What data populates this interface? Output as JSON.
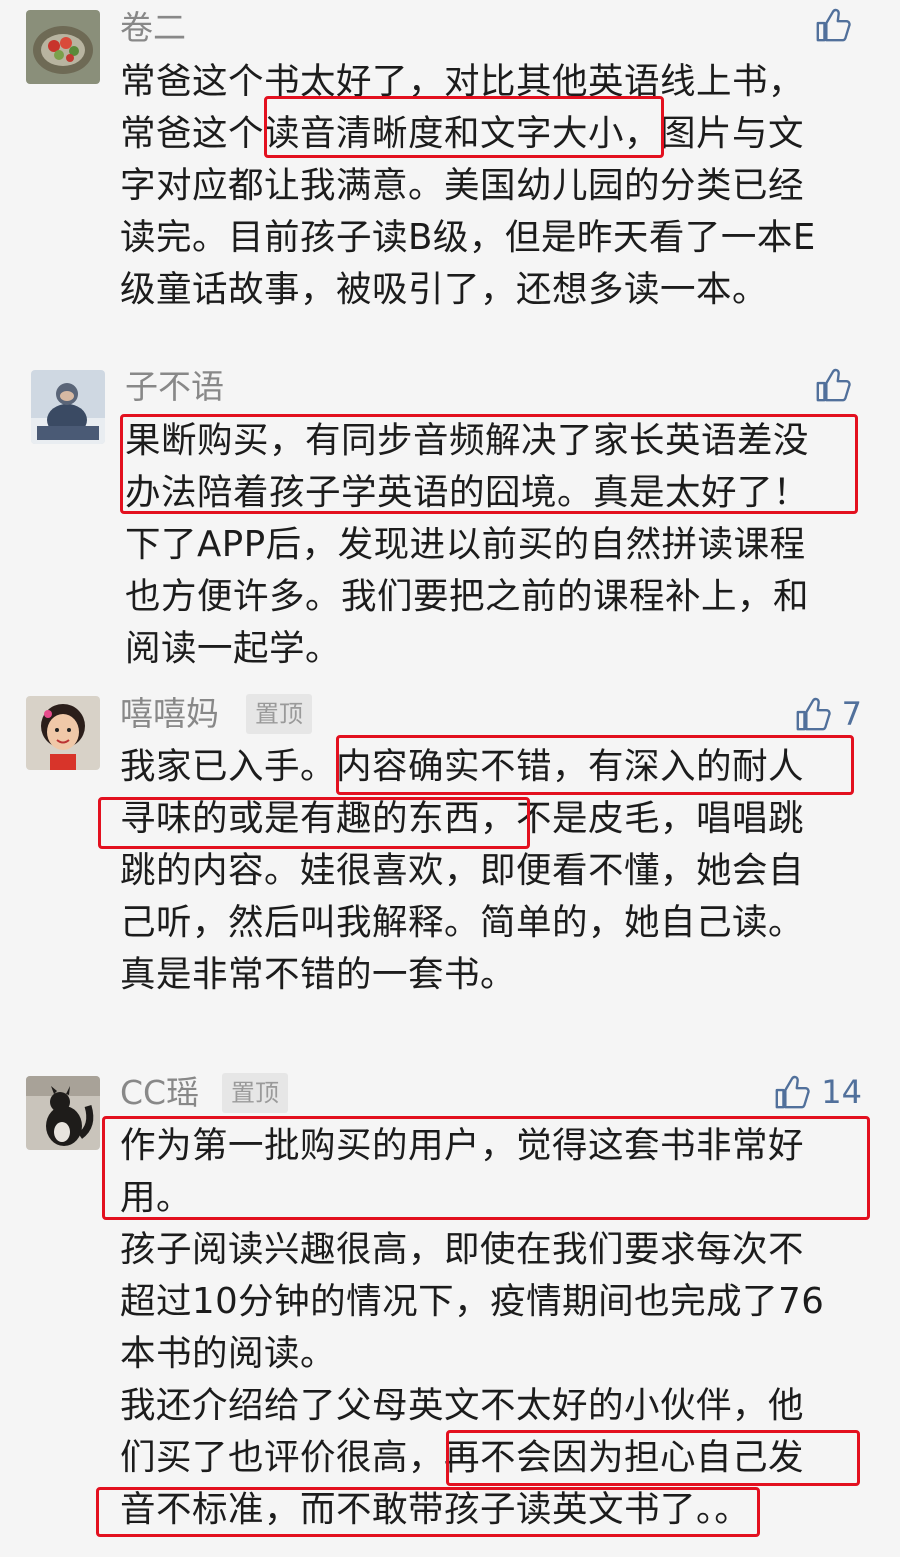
{
  "comments": [
    {
      "author": "卷二",
      "pinned": false,
      "pin_label": "",
      "likes": "",
      "lines": [
        "常爸这个书太好了，对比其他英语线上书，",
        "常爸这个读音清晰度和文字大小，图片与文",
        "字对应都让我满意。美国幼儿园的分类已经",
        "读完。目前孩子读B级，但是昨天看了一本E",
        "级童话故事，被吸引了，还想多读一本。"
      ]
    },
    {
      "author": "子不语",
      "pinned": false,
      "pin_label": "",
      "likes": "",
      "lines": [
        "果断购买，有同步音频解决了家长英语差没",
        "办法陪着孩子学英语的囧境。真是太好了！",
        "下了APP后，发现进以前买的自然拼读课程",
        "也方便许多。我们要把之前的课程补上，和",
        "阅读一起学。"
      ]
    },
    {
      "author": "嘻嘻妈",
      "pinned": true,
      "pin_label": "置顶",
      "likes": "7",
      "lines": [
        "我家已入手。内容确实不错，有深入的耐人",
        "寻味的或是有趣的东西，不是皮毛，唱唱跳",
        "跳的内容。娃很喜欢，即便看不懂，她会自",
        "己听，然后叫我解释。简单的，她自己读。",
        "真是非常不错的一套书。"
      ]
    },
    {
      "author": "CC瑶",
      "pinned": true,
      "pin_label": "置顶",
      "likes": "14",
      "lines": [
        "作为第一批购买的用户，觉得这套书非常好",
        "用。",
        "孩子阅读兴趣很高，即使在我们要求每次不",
        "超过10分钟的情况下，疫情期间也完成了76",
        "本书的阅读。",
        "我还介绍给了父母英文不太好的小伙伴，他",
        "们买了也评价很高，再不会因为担心自己发",
        "音不标准，而不敢带孩子读英文书了。。"
      ]
    }
  ],
  "icons": {
    "like": "thumbs-up-icon"
  },
  "colors": {
    "like": "#51709b",
    "highlight": "#e3101f",
    "name": "#888888",
    "text": "#1c1c1c",
    "background": "#f5f5f5"
  }
}
